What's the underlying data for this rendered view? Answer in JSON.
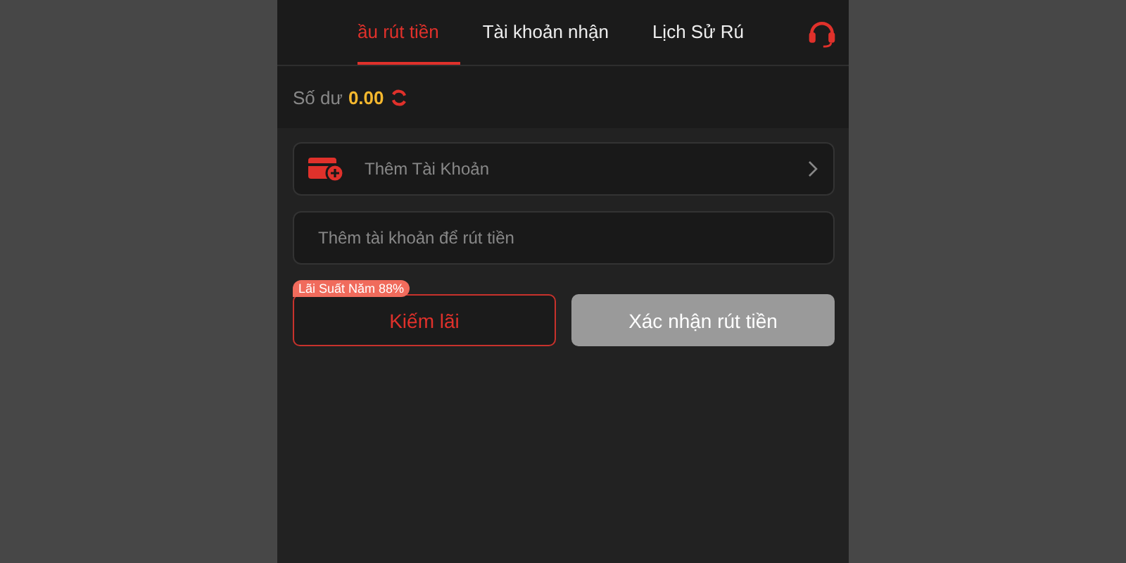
{
  "tabs": [
    {
      "label": "ầu rút tiền",
      "selected": true
    },
    {
      "label": "Tài khoản nhận",
      "selected": false
    },
    {
      "label": "Lịch Sử Rú",
      "selected": false
    }
  ],
  "balance": {
    "label": "Số dư",
    "amount": "0.00"
  },
  "add_account": {
    "label": "Thêm Tài Khoản"
  },
  "account_field": {
    "placeholder": "Thêm tài khoản để rút tiền"
  },
  "promo_badge": "Lãi Suất Năm 88%",
  "buttons": [
    {
      "label": "Kiếm lãi",
      "kind": "outline"
    },
    {
      "label": "Xác nhận rút tiền",
      "kind": "filled"
    }
  ]
}
